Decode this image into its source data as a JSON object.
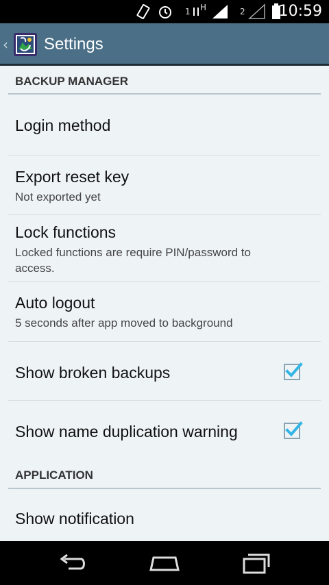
{
  "status_bar": {
    "sim1_label": "1",
    "network1_type": "H",
    "sim2_label": "2",
    "time": "10:59"
  },
  "action_bar": {
    "title": "Settings"
  },
  "sections": [
    {
      "header": "BACKUP MANAGER",
      "items": [
        {
          "title": "Login method",
          "summary": ""
        },
        {
          "title": "Export reset key",
          "summary": "Not exported yet"
        },
        {
          "title": "Lock functions",
          "summary": "Locked functions are require PIN/password to access."
        },
        {
          "title": "Auto logout",
          "summary": "5 seconds after app moved to background"
        },
        {
          "title": "Show broken backups",
          "summary": "",
          "checked": true
        },
        {
          "title": "Show name duplication warning",
          "summary": "",
          "checked": true
        }
      ]
    },
    {
      "header": "APPLICATION",
      "items": [
        {
          "title": "Show notification",
          "summary": ""
        }
      ]
    }
  ],
  "colors": {
    "action_bar": "#4a6f86",
    "background": "#eef3f6",
    "checkbox_accent": "#33b5e5"
  }
}
